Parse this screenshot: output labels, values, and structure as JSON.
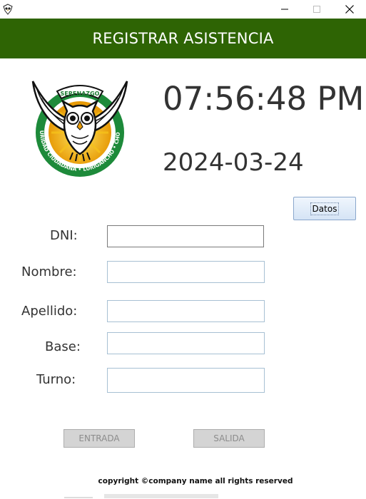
{
  "window": {
    "minimize_icon": "minimize-icon",
    "maximize_icon": "maximize-icon",
    "close_icon": "close-icon"
  },
  "header": {
    "title": "REGISTRAR ASISTENCIA",
    "color": "#2e6404"
  },
  "logo": {
    "top_text": "SERENAZGO",
    "ring_text": "SEGURIDAD CIUDADANA • LURIGANCHO • CHOSICA"
  },
  "clock": {
    "time": "07:56:48 PM",
    "date": "2024-03-24"
  },
  "datos_button": {
    "label": "Datos"
  },
  "form": {
    "dni": {
      "label": "DNI:",
      "value": ""
    },
    "nombre": {
      "label": "Nombre:",
      "value": ""
    },
    "apellido": {
      "label": "Apellido:",
      "value": ""
    },
    "base": {
      "label": "Base:",
      "value": ""
    },
    "turno": {
      "label": "Turno:",
      "value": ""
    }
  },
  "actions": {
    "entrada": "ENTRADA",
    "salida": "SALIDA"
  },
  "footer": {
    "copyright": "copyright ©company name all rights reserved"
  }
}
